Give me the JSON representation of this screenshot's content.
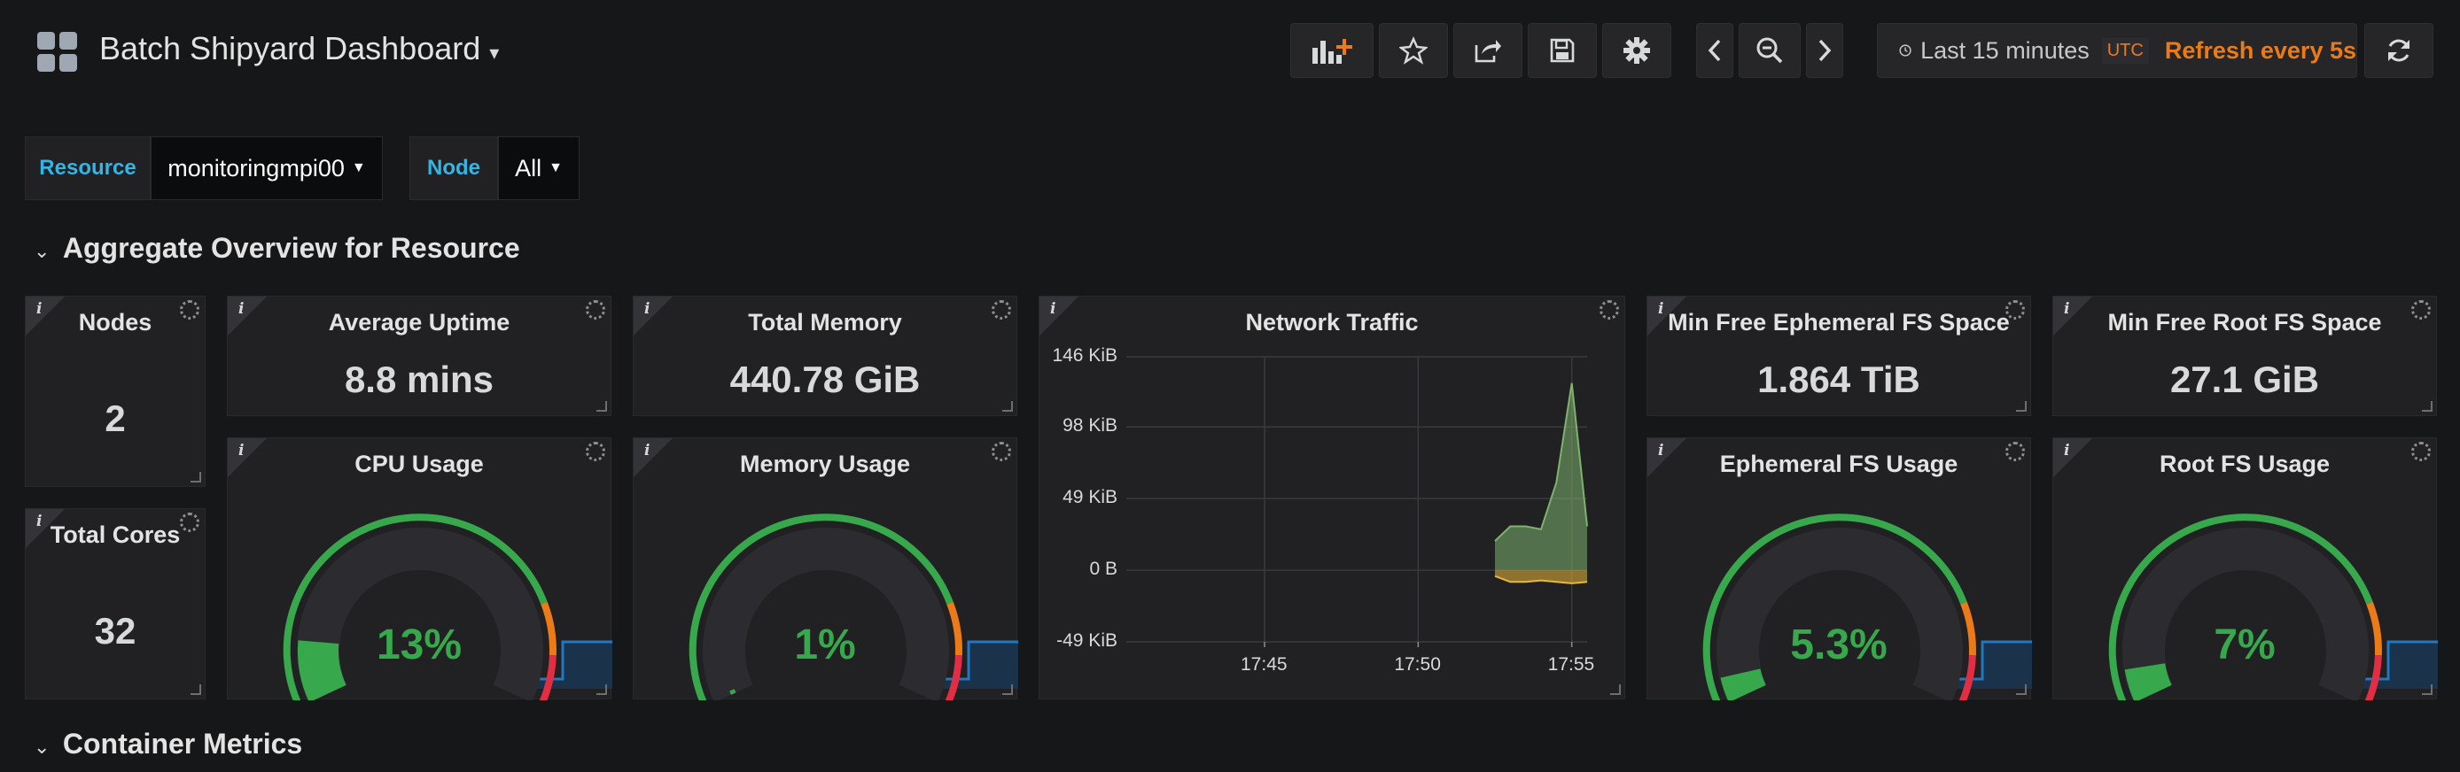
{
  "header": {
    "title": "Batch Shipyard Dashboard",
    "icons": [
      "dashboard-grid-icon",
      "add-panel-icon",
      "star-icon",
      "share-icon",
      "save-icon",
      "gear-icon",
      "chevron-left-icon",
      "zoom-out-icon",
      "chevron-right-icon",
      "clock-icon",
      "refresh-icon"
    ],
    "time_range": "Last 15 minutes",
    "timezone": "UTC",
    "refresh": "Refresh every 5s",
    "accent": "#eb7b18"
  },
  "variables": {
    "resource_label": "Resource",
    "resource_value": "monitoringmpi00",
    "node_label": "Node",
    "node_value": "All",
    "label_color": "#33b5e5"
  },
  "rows": {
    "aggregate": "Aggregate Overview for Resource",
    "container": "Container Metrics"
  },
  "panels": {
    "nodes": {
      "title": "Nodes",
      "value": "2"
    },
    "total_cores": {
      "title": "Total Cores",
      "value": "32"
    },
    "avg_uptime": {
      "title": "Average Uptime",
      "value": "8.8 mins"
    },
    "total_memory": {
      "title": "Total Memory",
      "value": "440.78 GiB"
    },
    "min_free_ephemeral": {
      "title": "Min Free Ephemeral FS Space",
      "value": "1.864 TiB"
    },
    "min_free_root": {
      "title": "Min Free Root FS Space",
      "value": "27.1 GiB"
    },
    "cpu_usage": {
      "title": "CPU Usage",
      "value": "13%",
      "percent": 13
    },
    "memory_usage": {
      "title": "Memory Usage",
      "value": "1%",
      "percent": 1
    },
    "ephemeral_usage": {
      "title": "Ephemeral FS Usage",
      "value": "5.3%",
      "percent": 5.3
    },
    "root_usage": {
      "title": "Root FS Usage",
      "value": "7%",
      "percent": 7
    },
    "network": {
      "title": "Network Traffic"
    }
  },
  "colors": {
    "gauge_ok": "#37a84c",
    "gauge_warn": "#eb7b18",
    "gauge_crit": "#e02f44",
    "sparkline": "#1f78c1"
  },
  "chart_data": {
    "type": "area",
    "title": "Network Traffic",
    "yticks": [
      "146 KiB",
      "98 KiB",
      "49 KiB",
      "0 B",
      "-49 KiB"
    ],
    "ylim": [
      -49,
      146
    ],
    "xticks": [
      "17:45",
      "17:50",
      "17:55"
    ],
    "series": [
      {
        "values": [
          {
            "x": "17:52:30",
            "y": 20
          },
          {
            "x": "17:53:00",
            "y": 30
          },
          {
            "x": "17:53:30",
            "y": 30
          },
          {
            "x": "17:54:00",
            "y": 28
          },
          {
            "x": "17:54:30",
            "y": 60
          },
          {
            "x": "17:55:00",
            "y": 128
          },
          {
            "x": "17:55:30",
            "y": 30
          }
        ]
      },
      {
        "values": [
          {
            "x": "17:52:30",
            "y": -4
          },
          {
            "x": "17:53:00",
            "y": -8
          },
          {
            "x": "17:53:30",
            "y": -8
          },
          {
            "x": "17:54:00",
            "y": -7
          },
          {
            "x": "17:54:30",
            "y": -8
          },
          {
            "x": "17:55:00",
            "y": -9
          },
          {
            "x": "17:55:30",
            "y": -8
          }
        ]
      }
    ],
    "colors": [
      "#7eb26d",
      "#eab839"
    ],
    "grid": true
  }
}
